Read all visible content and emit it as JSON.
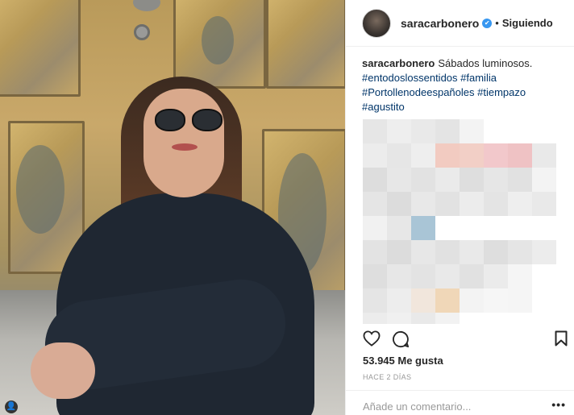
{
  "post": {
    "username": "saracarbonero",
    "verified_glyph": "✔",
    "separator": "•",
    "follow_status": "Siguiendo",
    "user_tag_icon": "person-icon",
    "user_tag_glyph": "👤"
  },
  "caption": {
    "username": "saracarbonero",
    "text": "Sábados luminosos.",
    "hashtags": [
      "#entodoslossentidos",
      "#familia",
      "#Portollenodeespañoles",
      "#tiempazo",
      "#agustito"
    ]
  },
  "engagement": {
    "likes": "53.945 Me gusta",
    "time_ago": "HACE 2 DÍAS",
    "comment_placeholder": "Añade un comentario...",
    "more_glyph": "•••"
  },
  "icons": {
    "like": "heart-icon",
    "comment": "comment-icon",
    "save": "bookmark-icon",
    "verified": "verified-badge-icon"
  },
  "colors": {
    "accent_verified": "#3897f0",
    "hashtag": "#003569",
    "text": "#262626",
    "muted": "#999999"
  }
}
